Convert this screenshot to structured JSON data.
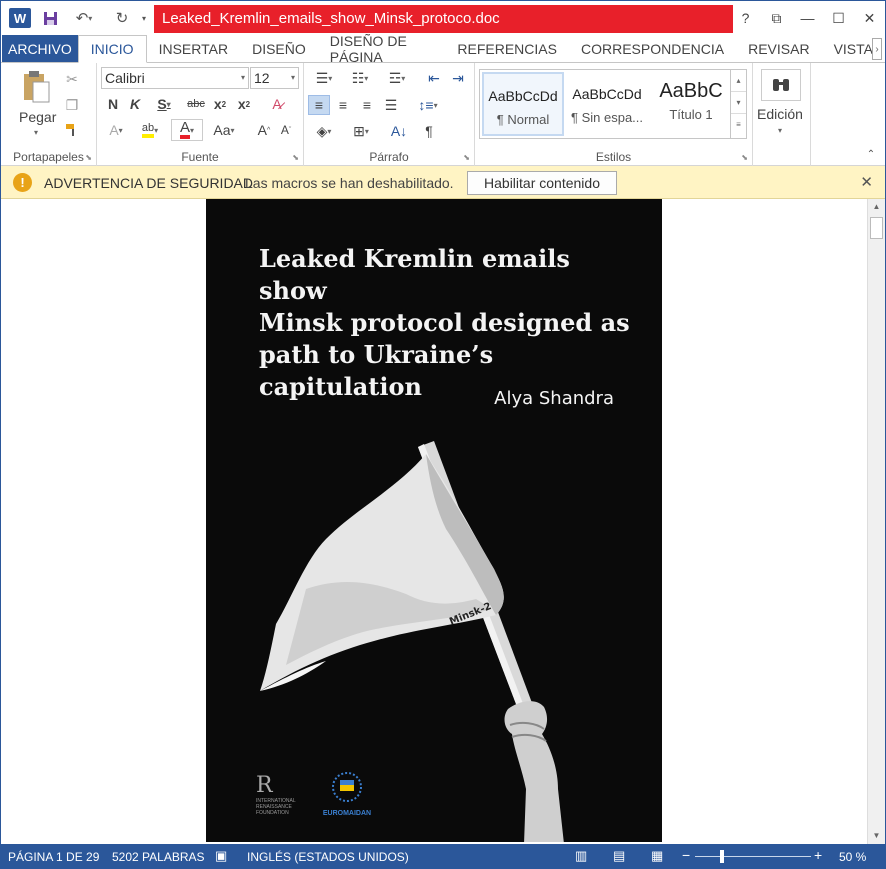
{
  "titlebar": {
    "doc_title": "Leaked_Kremlin_emails_show_Minsk_protoco.doc",
    "help": "?"
  },
  "tabs": [
    {
      "label": "ARCHIVO"
    },
    {
      "label": "INICIO"
    },
    {
      "label": "INSERTAR"
    },
    {
      "label": "DISEÑO"
    },
    {
      "label": "DISEÑO DE PÁGINA"
    },
    {
      "label": "REFERENCIAS"
    },
    {
      "label": "CORRESPONDENCIA"
    },
    {
      "label": "REVISAR"
    },
    {
      "label": "VISTA"
    }
  ],
  "ribbon": {
    "clipboard": {
      "paste": "Pegar",
      "label": "Portapapeles"
    },
    "font": {
      "name": "Calibri",
      "size": "12",
      "label": "Fuente"
    },
    "paragraph": {
      "label": "Párrafo"
    },
    "styles": {
      "label": "Estilos",
      "items": [
        {
          "preview": "AaBbCcDd",
          "name": "¶ Normal"
        },
        {
          "preview": "AaBbCcDd",
          "name": "¶ Sin espa..."
        },
        {
          "preview": "AaBbC",
          "name": "Título 1"
        }
      ]
    },
    "editing": {
      "label": "Edición"
    }
  },
  "security": {
    "title": "ADVERTENCIA DE SEGURIDAD",
    "message": "Las macros se han deshabilitado.",
    "button": "Habilitar contenido"
  },
  "cover": {
    "title_lines": [
      "Leaked Kremlin emails show",
      "Minsk protocol designed as",
      "path to Ukraine’s capitulation"
    ],
    "author": "Alya Shandra",
    "flag_text": "Minsk-2",
    "logo_left": "INTERNATIONAL RENAISSANCE FOUNDATION",
    "logo_right": "EUROMAIDAN"
  },
  "status": {
    "page": "PÁGINA 1 DE 29",
    "words": "5202 PALABRAS",
    "language": "INGLÉS (ESTADOS UNIDOS)",
    "zoom": "50 %"
  },
  "colors": {
    "accent": "#2b579a",
    "title_highlight": "#e8202a",
    "security_bg": "#fff4c4"
  }
}
